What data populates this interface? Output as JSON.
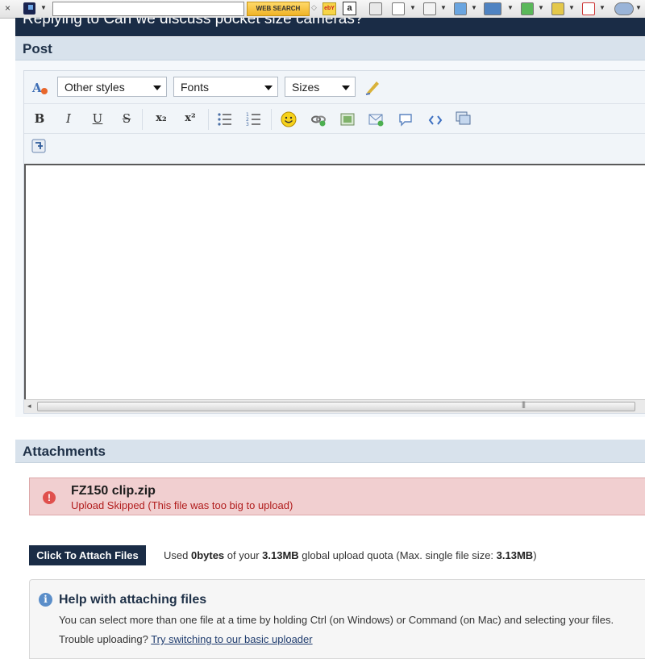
{
  "toolbar": {
    "close": "×",
    "search_value": "",
    "web_search": "WEB SEARCH",
    "ebay": "ebY",
    "amazon": "a"
  },
  "page": {
    "reply_header": "Replying to Can we discuss pocket size cameras?",
    "post_section": "Post",
    "attachments_section": "Attachments"
  },
  "editor": {
    "styles_dropdown": "Other styles",
    "fonts_dropdown": "Fonts",
    "sizes_dropdown": "Sizes",
    "bold": "B",
    "italic": "I",
    "underline": "U",
    "strike": "S",
    "subscript": "x₂",
    "superscript": "x²",
    "content": ""
  },
  "attachments": {
    "error_file": "FZ150 clip.zip",
    "error_message": "Upload Skipped (This file was too big to upload)",
    "attach_button": "Click To Attach Files",
    "quota_used_label": "Used ",
    "quota_used": "0bytes",
    "quota_of": " of your ",
    "quota_total": "3.13MB",
    "quota_mid": " global upload quota (Max. single file size: ",
    "quota_max": "3.13MB",
    "quota_end": ")"
  },
  "help": {
    "title": "Help with attaching files",
    "text": "You can select more than one file at a time by holding Ctrl (on Windows) or Command (on Mac) and selecting your files.",
    "trouble_label": "Trouble uploading? ",
    "trouble_link": "Try switching to our basic uploader"
  },
  "colors": {
    "header_navy": "#1a2c46",
    "section_bar": "#d8e2ec",
    "error_bg": "#f1cfd0",
    "error_text": "#b11d1d"
  }
}
